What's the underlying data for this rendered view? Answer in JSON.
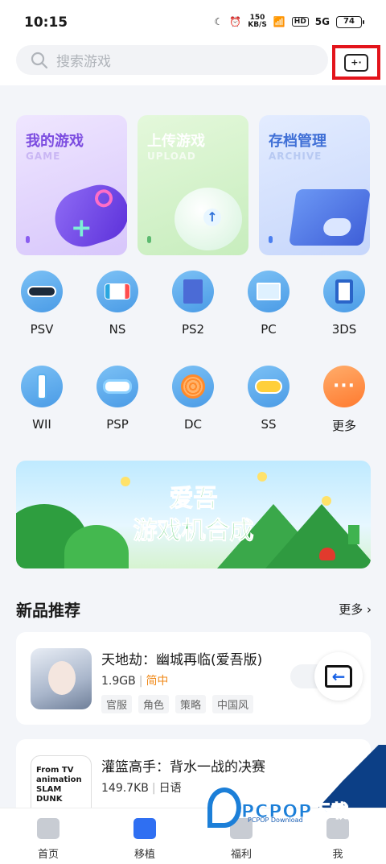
{
  "status_bar": {
    "time": "10:15",
    "speed_value": "150",
    "speed_unit": "KB/S",
    "hd": "HD",
    "network": "5G",
    "battery": "74"
  },
  "search": {
    "placeholder": "搜索游戏"
  },
  "feature_cards": [
    {
      "title": "我的游戏",
      "subtitle": "GAME"
    },
    {
      "title": "上传游戏",
      "subtitle": "UPLOAD"
    },
    {
      "title": "存档管理",
      "subtitle": "ARCHIVE"
    }
  ],
  "platforms": [
    {
      "label": "PSV",
      "icon": "handheld-console-icon"
    },
    {
      "label": "NS",
      "icon": "switch-console-icon"
    },
    {
      "label": "PS2",
      "icon": "ps2-disc-case-icon"
    },
    {
      "label": "PC",
      "icon": "monitor-icon"
    },
    {
      "label": "3DS",
      "icon": "dual-screen-handheld-icon"
    },
    {
      "label": "WII",
      "icon": "wii-remote-icon"
    },
    {
      "label": "PSP",
      "icon": "psp-handheld-icon"
    },
    {
      "label": "DC",
      "icon": "dreamcast-swirl-icon"
    },
    {
      "label": "SS",
      "icon": "gamepad-icon"
    },
    {
      "label": "更多",
      "icon": "more-dots-icon"
    }
  ],
  "banner": {
    "line1": "爱吾",
    "line2": "游戏机合成"
  },
  "section": {
    "title": "新品推荐",
    "more": "更多"
  },
  "games": [
    {
      "name": "天地劫：幽城再临(爱吾版)",
      "size": "1.9GB",
      "lang": "简中",
      "tags": [
        "官服",
        "角色",
        "策略",
        "中国风"
      ]
    },
    {
      "name": "灌篮高手：背水一战的决赛",
      "size": "149.7KB",
      "lang": "日语",
      "thumb_text": "From TV animation SLAM DUNK"
    }
  ],
  "bottom_nav": [
    {
      "label": "首页"
    },
    {
      "label": "移植"
    },
    {
      "label": "福利"
    },
    {
      "label": "我"
    }
  ],
  "watermark": {
    "text": "PCPOP下载",
    "sub": "PCPOP Download"
  }
}
